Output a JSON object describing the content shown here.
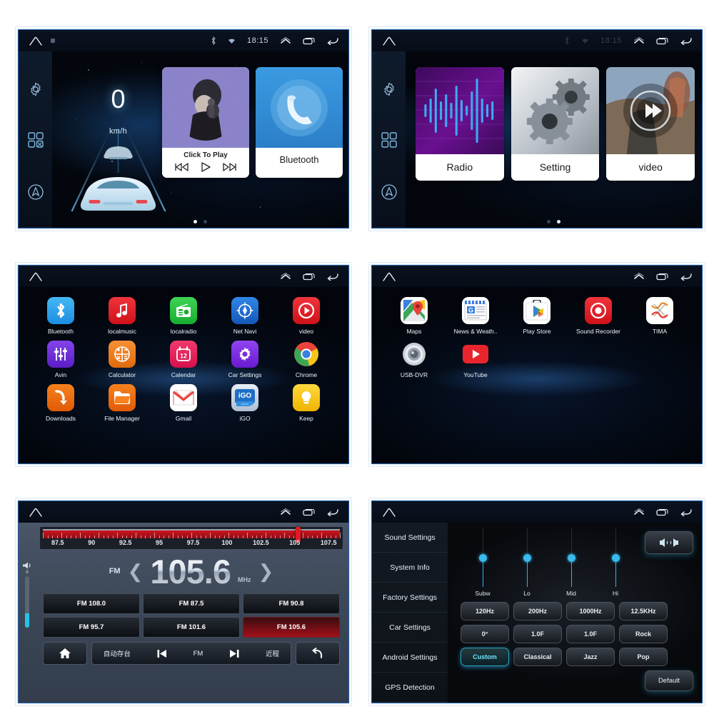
{
  "statusbar": {
    "time": "18:15",
    "icons": [
      "bluetooth-icon",
      "wifi-icon",
      "chevron-up-icon",
      "recents-icon",
      "back-icon",
      "home-icon"
    ]
  },
  "rail": {
    "icons": [
      "gear-icon",
      "apps-grid-icon",
      "navigation-icon"
    ]
  },
  "panel1": {
    "speed_value": "0",
    "speed_unit": "km/h",
    "music_card": {
      "title": "Click To Play",
      "prev": "prev-track-icon",
      "play": "play-icon",
      "next": "next-track-icon"
    },
    "bluetooth_card": {
      "label": "Bluetooth"
    },
    "page_dots": 2,
    "active_dot": 0
  },
  "panel2": {
    "tiles": [
      {
        "label": "Radio",
        "art": "waveform"
      },
      {
        "label": "Setting",
        "art": "gears"
      },
      {
        "label": "video",
        "art": "movie"
      }
    ],
    "page_dots": 2,
    "active_dot": 1
  },
  "panel3": {
    "apps": [
      {
        "name": "Bluetooth",
        "icon": "bluetooth-icon",
        "color": "#2aa3ef"
      },
      {
        "name": "localmusic",
        "icon": "music-note-icon",
        "color": "#e8252d"
      },
      {
        "name": "localradio",
        "icon": "radio-icon",
        "color": "#2fc44a"
      },
      {
        "name": "Net Navi",
        "icon": "compass-icon",
        "color": "#1f6fd6"
      },
      {
        "name": "video",
        "icon": "play-circle-icon",
        "color": "#e8252d"
      },
      {
        "name": "Avin",
        "icon": "sliders-icon",
        "color": "#6d2fd6"
      },
      {
        "name": "Calculator",
        "icon": "calculator-icon",
        "color": "#ef7a23"
      },
      {
        "name": "Calendar",
        "icon": "calendar-icon",
        "color": "#e8245c"
      },
      {
        "name": "Car Settings",
        "icon": "gear-icon",
        "color": "#7a33e0"
      },
      {
        "name": "Chrome",
        "icon": "chrome-icon",
        "color": "#ffffff"
      },
      {
        "name": "Downloads",
        "icon": "download-icon",
        "color": "#ef6a17"
      },
      {
        "name": "File Manager",
        "icon": "folder-icon",
        "color": "#ef6a17"
      },
      {
        "name": "Gmail",
        "icon": "envelope-icon",
        "color": "#ffffff"
      },
      {
        "name": "iGO",
        "icon": "igo-icon",
        "color": "#1a6fc4"
      },
      {
        "name": "Keep",
        "icon": "bulb-icon",
        "color": "#f5c518"
      }
    ]
  },
  "panel4": {
    "apps": [
      {
        "name": "Maps",
        "icon": "maps-pin-icon",
        "color": "#ffffff"
      },
      {
        "name": "News & Weath..",
        "icon": "news-icon",
        "color": "#ffffff"
      },
      {
        "name": "Play Store",
        "icon": "play-store-icon",
        "color": "#ffffff"
      },
      {
        "name": "Sound Recorder",
        "icon": "record-dot-icon",
        "color": "#e8252d"
      },
      {
        "name": "TIMA",
        "icon": "tima-icon",
        "color": "#ffffff"
      },
      {
        "name": "USB-DVR",
        "icon": "camera-lens-icon",
        "color": "#c9ced6"
      },
      {
        "name": "YouTube",
        "icon": "youtube-icon",
        "color": "#e8252d"
      }
    ]
  },
  "panel5": {
    "band": "FM",
    "frequency": "105.6",
    "unit": "MHz",
    "needle_percent": 85,
    "volume_level": "8",
    "scale_labels": [
      "87.5",
      "90",
      "92.5",
      "95",
      "97.5",
      "100",
      "102.5",
      "105",
      "107.5"
    ],
    "presets": [
      {
        "label": "FM 108.0",
        "active": false
      },
      {
        "label": "FM 87.5",
        "active": false
      },
      {
        "label": "FM 90.8",
        "active": false
      },
      {
        "label": "FM 95.7",
        "active": false
      },
      {
        "label": "FM 101.6",
        "active": false
      },
      {
        "label": "FM 105.6",
        "active": true
      }
    ],
    "toolbar": {
      "home": "home-icon",
      "auto_store": "自动存台",
      "prev": "prev-track-icon",
      "band_label": "FM",
      "next": "next-track-icon",
      "range": "近程",
      "back": "back-arrow-icon"
    }
  },
  "panel6": {
    "menu": [
      "Sound Settings",
      "System Info",
      "Factory Settings",
      "Car Settings",
      "Android Settings",
      "GPS Detection"
    ],
    "sliders": [
      {
        "name": "Subw",
        "value": 50
      },
      {
        "name": "Lo",
        "value": 50
      },
      {
        "name": "Mid",
        "value": 50
      },
      {
        "name": "Hi",
        "value": 50
      }
    ],
    "eq_buttons": [
      {
        "label": "120Hz",
        "active": false
      },
      {
        "label": "200Hz",
        "active": false
      },
      {
        "label": "1000Hz",
        "active": false
      },
      {
        "label": "12.5KHz",
        "active": false
      },
      {
        "label": "0°",
        "active": false
      },
      {
        "label": "1.0F",
        "active": false
      },
      {
        "label": "1.0F",
        "active": false
      },
      {
        "label": "Rock",
        "active": false
      },
      {
        "label": "Custom",
        "active": true
      },
      {
        "label": "Classical",
        "active": false
      },
      {
        "label": "Jazz",
        "active": false
      },
      {
        "label": "Pop",
        "active": false
      }
    ],
    "balance_button": "balance-speaker-icon",
    "default_button": "Default"
  },
  "colors": {
    "accent_cyan": "#2fb4e8",
    "accent_red": "#e01b26",
    "bezel": "#1d5fa8"
  }
}
